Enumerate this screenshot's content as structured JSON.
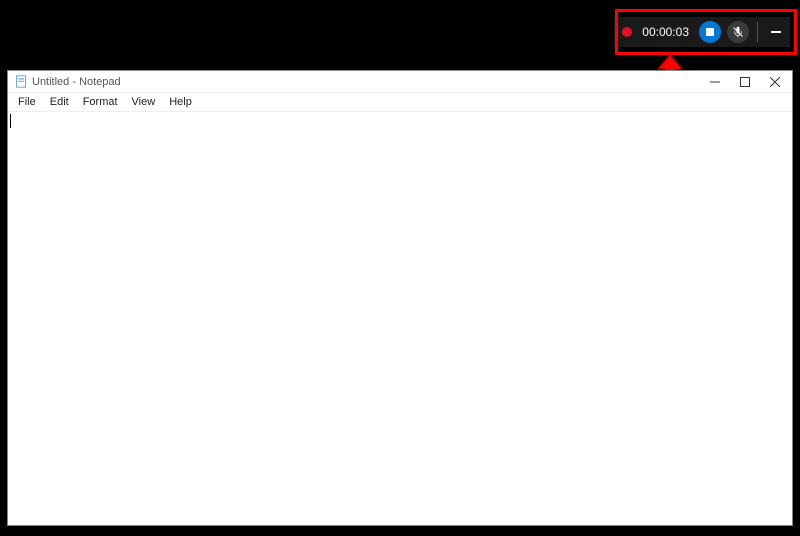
{
  "recording": {
    "time": "00:00:03"
  },
  "notepad": {
    "title": "Untitled - Notepad",
    "menu": {
      "file": "File",
      "edit": "Edit",
      "format": "Format",
      "view": "View",
      "help": "Help"
    },
    "content": ""
  }
}
